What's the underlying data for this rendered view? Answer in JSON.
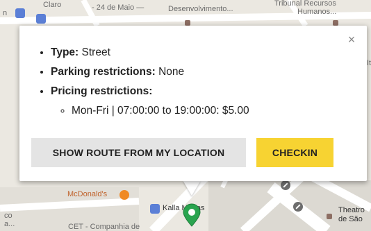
{
  "map": {
    "labels": {
      "claro": "Claro",
      "street_top": "- 24 de Maio —",
      "desenvolvimento": "Desenvolvimento...",
      "humanos_top": "Tribunal Recursos",
      "humanos": "Humanos...",
      "mcdonalds": "McDonald's",
      "kalla": "Kalla Modas",
      "theatro": "Theatro",
      "de_sao": "de São",
      "left_bottom1": "co",
      "left_bottom2": "a...",
      "cet": "CET - Companhia de",
      "right_it": "It"
    }
  },
  "info_window": {
    "close_glyph": "×",
    "type_label": "Type:",
    "type_value": "Street",
    "parking_label": "Parking restrictions:",
    "parking_value": "None",
    "pricing_label": "Pricing restrictions:",
    "pricing_items": [
      "Mon-Fri | 07:00:00 to 19:00:00: $5.00"
    ],
    "route_button": "SHOW ROUTE FROM MY LOCATION",
    "checkin_button": "CHECKIN"
  },
  "colors": {
    "checkin_bg": "#f7d332",
    "route_bg": "#e4e4e4",
    "pin": "#2aa44f"
  }
}
